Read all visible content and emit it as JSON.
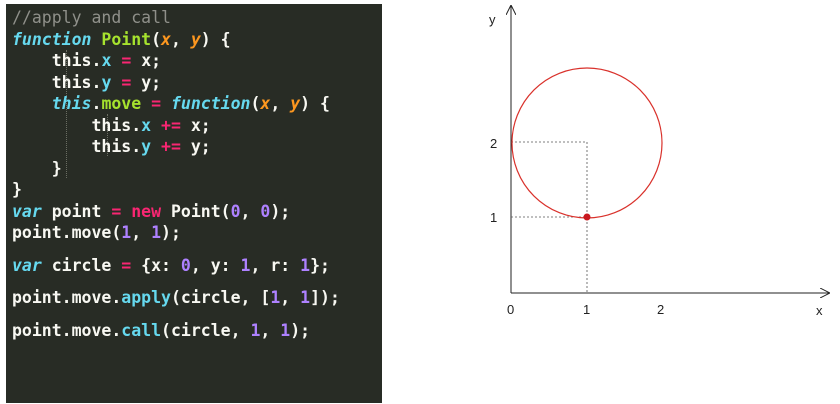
{
  "code": {
    "comment": "//apply and call",
    "kw_function": "function",
    "kw_var": "var",
    "kw_new": "new",
    "kw_this": "this",
    "fn_point": "Point",
    "prop_x": "x",
    "prop_y": "y",
    "prop_move": "move",
    "param_x": "x",
    "param_y": "y",
    "id_point": "point",
    "id_circle": "circle",
    "id_this": "this",
    "method_apply": "apply",
    "method_call": "call",
    "num_0": "0",
    "num_1": "1",
    "op_assign": "=",
    "op_add_assign": "+=",
    "lit_x_key": "x:",
    "lit_y_key": "y:",
    "lit_r_key": "r:"
  },
  "diagram": {
    "axis_x_label": "x",
    "axis_y_label": "y",
    "x_ticks": [
      "0",
      "1",
      "2"
    ],
    "y_ticks": [
      "1",
      "2"
    ],
    "circle_color": "#d9312b",
    "point_color": "#c8181e",
    "guide_color": "#555555"
  }
}
